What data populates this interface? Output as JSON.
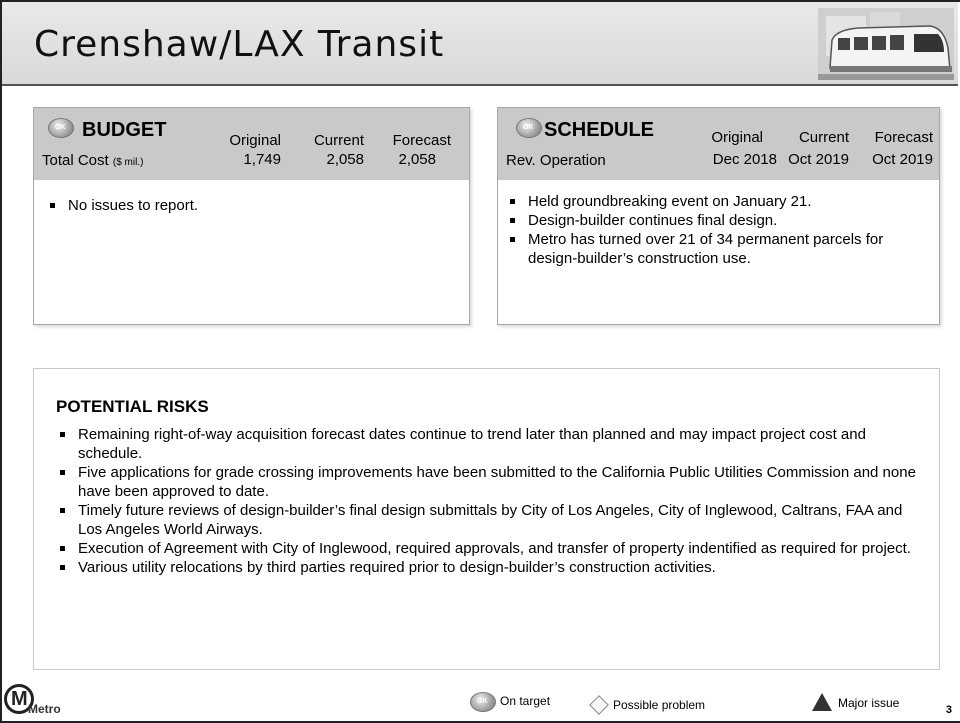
{
  "title": "Crenshaw/LAX Transit",
  "budget": {
    "heading": "BUDGET",
    "row_label": "Total Cost",
    "row_unit": "($ mil.)",
    "columns": [
      "Original",
      "Current",
      "Forecast"
    ],
    "values": [
      "1,749",
      "2,058",
      "2,058"
    ],
    "bullets": [
      "No issues to report."
    ]
  },
  "schedule": {
    "heading": "SCHEDULE",
    "row_label": "Rev. Operation",
    "columns": [
      "Original",
      "Current",
      "Forecast"
    ],
    "values": [
      "Dec 2018",
      "Oct 2019",
      "Oct 2019"
    ],
    "bullets": [
      "Held groundbreaking event on January 21.",
      "Design-builder continues final design.",
      "Metro has turned over 21 of 34 permanent parcels for design-builder’s construction use."
    ]
  },
  "risks": {
    "heading": "POTENTIAL RISKS",
    "bullets": [
      "Remaining right-of-way acquisition forecast dates continue to trend later than planned and may impact project cost and schedule.",
      "Five applications for grade crossing improvements have been submitted to the California Public Utilities Commission and none have been approved to date.",
      "Timely future reviews of design-builder’s final design submittals by City of Los Angeles, City of Inglewood, Caltrans, FAA and Los Angeles World Airways.",
      "Execution of Agreement with City of Inglewood, required approvals, and transfer of property indentified as required for project.",
      "Various utility relocations by third parties required prior to design-builder’s construction activities."
    ]
  },
  "footer": {
    "logo_letter": "M",
    "logo_word": "Metro",
    "legend": {
      "on_target": "On target",
      "possible_problem": "Possible problem",
      "major_issue": "Major issue"
    },
    "page_number": "3"
  }
}
